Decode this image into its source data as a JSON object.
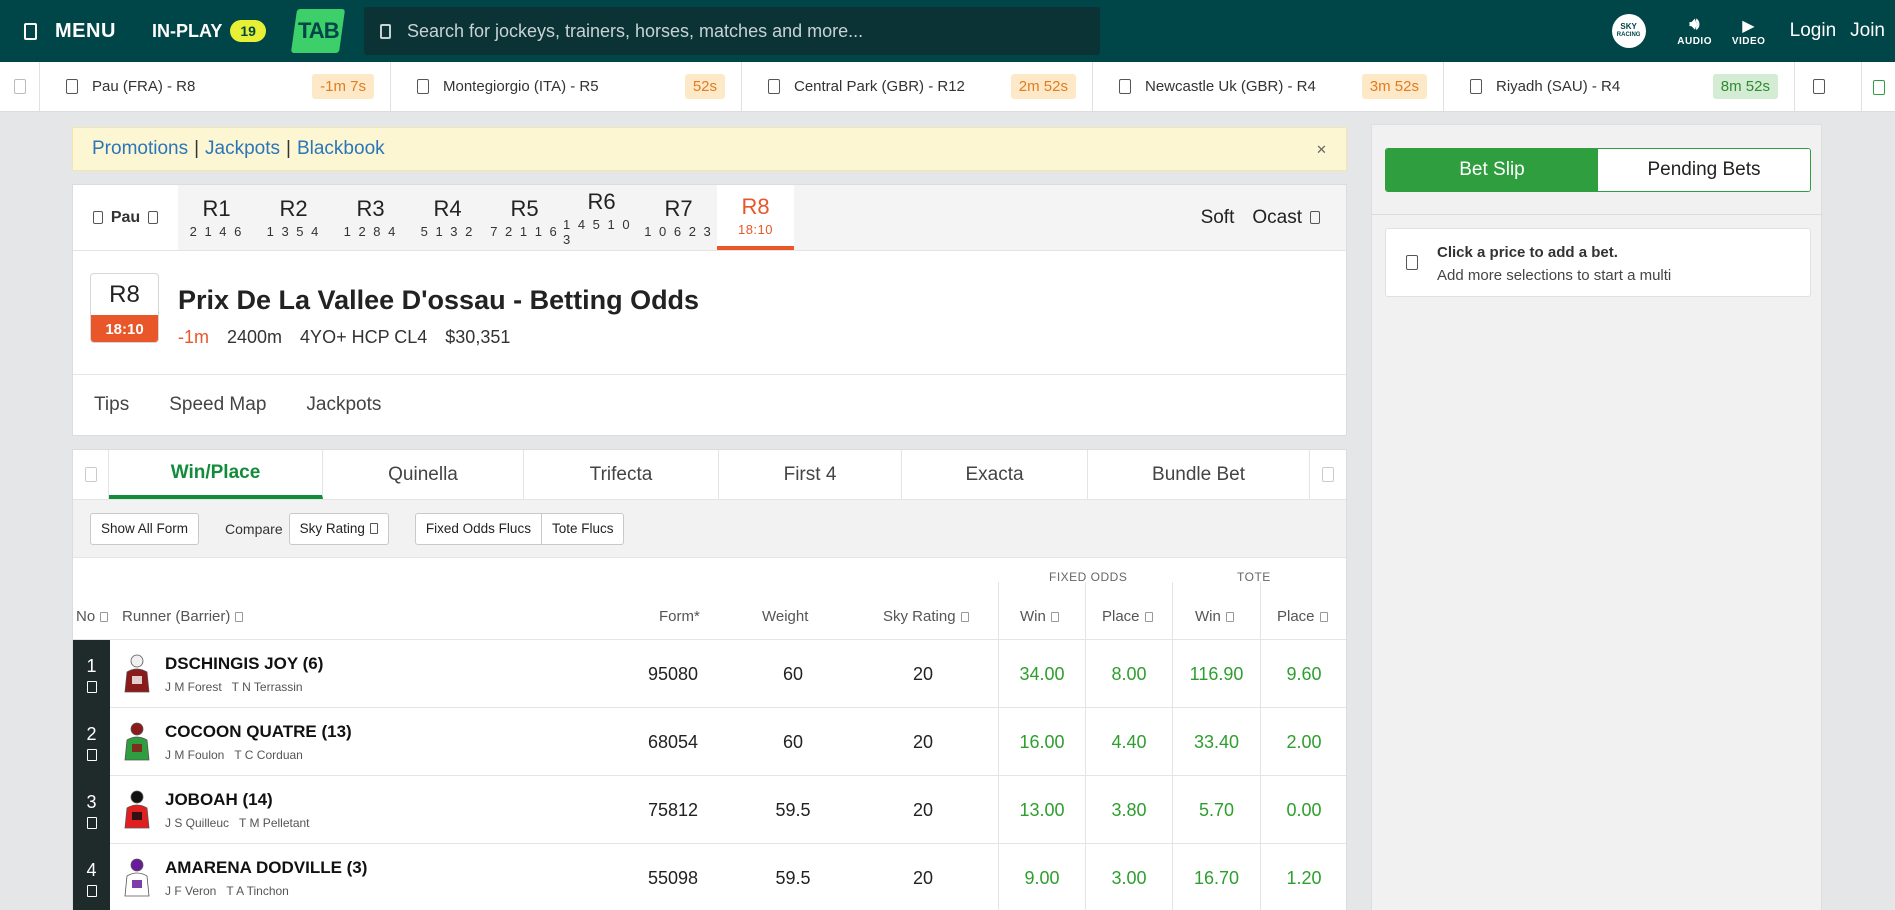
{
  "topbar": {
    "menu_label": "MENU",
    "inplay_label": "IN-PLAY",
    "inplay_count": "19",
    "logo_text": "TAB",
    "search_placeholder": "Search for jockeys, trainers, horses, matches and more...",
    "sky_logo_top": "SKY",
    "sky_logo_bottom": "RACING",
    "audio_label": "AUDIO",
    "video_label": "VIDEO",
    "login_label": "Login",
    "join_label": "Join"
  },
  "ticker": [
    {
      "label": "Pau (FRA) - R8",
      "time": "-1m 7s",
      "status": "orange"
    },
    {
      "label": "Montegiorgio (ITA) - R5",
      "time": "52s",
      "status": "orange"
    },
    {
      "label": "Central Park (GBR) - R12",
      "time": "2m 52s",
      "status": "orange"
    },
    {
      "label": "Newcastle Uk (GBR) - R4",
      "time": "3m 52s",
      "status": "orange"
    },
    {
      "label": "Riyadh (SAU) - R4",
      "time": "8m 52s",
      "status": "green"
    }
  ],
  "promo": {
    "promotions": "Promotions",
    "jackpots": "Jackpots",
    "blackbook": "Blackbook",
    "separator": "|"
  },
  "race_tabs": {
    "venue": "Pau",
    "races": [
      {
        "label": "R1",
        "sub": "2 1 4 6"
      },
      {
        "label": "R2",
        "sub": "1 3 5 4"
      },
      {
        "label": "R3",
        "sub": "1 2 8 4"
      },
      {
        "label": "R4",
        "sub": "5 1 3 2"
      },
      {
        "label": "R5",
        "sub": "7 2 1 1 6"
      },
      {
        "label": "R6",
        "sub": "1 4 5 1 0 3"
      },
      {
        "label": "R7",
        "sub": "1 0 6 2 3"
      },
      {
        "label": "R8",
        "sub": "18:10"
      }
    ],
    "track_condition": "Soft",
    "weather": "Ocast"
  },
  "race": {
    "number": "R8",
    "time": "18:10",
    "title": "Prix De La Vallee D'ossau - Betting Odds",
    "countdown": "-1m",
    "distance": "2400m",
    "class": "4YO+ HCP CL4",
    "prize": "$30,351"
  },
  "sub_tabs": [
    "Tips",
    "Speed Map",
    "Jackpots"
  ],
  "bet_types": [
    "Win/Place",
    "Quinella",
    "Trifecta",
    "First 4",
    "Exacta",
    "Bundle Bet"
  ],
  "toolbar": {
    "show_all_form": "Show All Form",
    "compare_label": "Compare",
    "compare_value": "Sky Rating",
    "fixed_flucs": "Fixed Odds Flucs",
    "tote_flucs": "Tote Flucs"
  },
  "columns": {
    "group_fixed": "FIXED ODDS",
    "group_tote": "TOTE",
    "no": "No",
    "runner": "Runner (Barrier)",
    "form": "Form*",
    "weight": "Weight",
    "rating": "Sky Rating",
    "fixed_win": "Win",
    "fixed_place": "Place",
    "tote_win": "Win",
    "tote_place": "Place"
  },
  "runners": [
    {
      "no": "1",
      "name": "DSCHINGIS JOY (6)",
      "jockey": "J M Forest",
      "trainer": "T N Terrassin",
      "form": "95080",
      "weight": "60",
      "rating": "20",
      "fixed_win": "34.00",
      "fixed_place": "8.00",
      "tote_win": "116.90",
      "tote_place": "9.60",
      "silk_body": "#8b1a1a",
      "silk_accent": "#f0f0f0"
    },
    {
      "no": "2",
      "name": "COCOON QUATRE (13)",
      "jockey": "J M Foulon",
      "trainer": "T C Corduan",
      "form": "68054",
      "weight": "60",
      "rating": "20",
      "fixed_win": "16.00",
      "fixed_place": "4.40",
      "tote_win": "33.40",
      "tote_place": "2.00",
      "silk_body": "#2e9e3e",
      "silk_accent": "#8b1a1a"
    },
    {
      "no": "3",
      "name": "JOBOAH (14)",
      "jockey": "J S Quilleuc",
      "trainer": "T M Pelletant",
      "form": "75812",
      "weight": "59.5",
      "rating": "20",
      "fixed_win": "13.00",
      "fixed_place": "3.80",
      "tote_win": "5.70",
      "tote_place": "0.00",
      "silk_body": "#e02020",
      "silk_accent": "#111111"
    },
    {
      "no": "4",
      "name": "AMARENA DODVILLE (3)",
      "jockey": "J F Veron",
      "trainer": "T A Tinchon",
      "form": "55098",
      "weight": "59.5",
      "rating": "20",
      "fixed_win": "9.00",
      "fixed_place": "3.00",
      "tote_win": "16.70",
      "tote_place": "1.20",
      "silk_body": "#ffffff",
      "silk_accent": "#6a1b9a"
    }
  ],
  "bet_slip": {
    "tab_slip": "Bet Slip",
    "tab_pending": "Pending Bets",
    "hint_title": "Click a price to add a bet.",
    "hint_sub": "Add more selections to start a multi"
  },
  "colors": {
    "nav_bg": "#004547",
    "accent_green": "#2e9e3e",
    "race_orange": "#e8562a",
    "price_green": "#2e9e2e"
  }
}
